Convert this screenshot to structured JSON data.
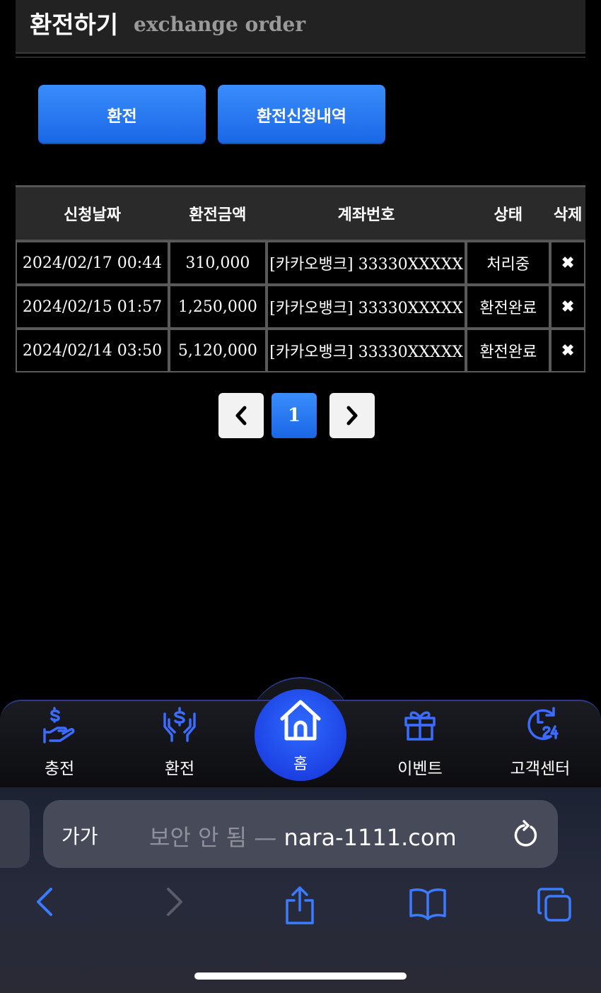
{
  "header": {
    "title_ko": "환전하기",
    "title_en": "exchange order"
  },
  "buttons": {
    "exchange": "환전",
    "history": "환전신청내역"
  },
  "table": {
    "columns": [
      "신청날짜",
      "환전금액",
      "계좌번호",
      "상태",
      "삭제"
    ],
    "rows": [
      {
        "date": "2024/02/17 00:44",
        "amount": "310,000",
        "account": "[카카오뱅크] 33330XXXXX",
        "status": "처리중",
        "delete": "✖"
      },
      {
        "date": "2024/02/15 01:57",
        "amount": "1,250,000",
        "account": "[카카오뱅크] 33330XXXXX",
        "status": "환전완료",
        "delete": "✖"
      },
      {
        "date": "2024/02/14 03:50",
        "amount": "5,120,000",
        "account": "[카카오뱅크] 33330XXXXX",
        "status": "환전완료",
        "delete": "✖"
      }
    ]
  },
  "pagination": {
    "current": "1"
  },
  "nav": {
    "charge": "충전",
    "exchange": "환전",
    "home": "홈",
    "event": "이벤트",
    "support": "고객센터"
  },
  "browser": {
    "text_size": "가가",
    "security": "보안 안 됨 — ",
    "domain": "nara-1111.com"
  },
  "colors": {
    "accent": "#1a66e6",
    "nav_icon": "#3b6cff",
    "link": "#4aa3ff"
  }
}
